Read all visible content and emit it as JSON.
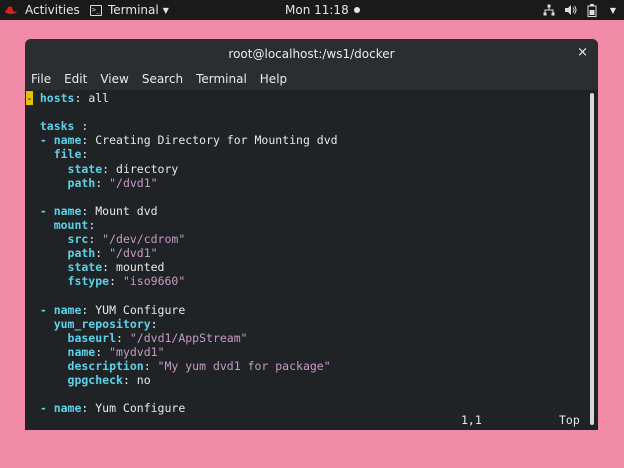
{
  "topbar": {
    "activities": "Activities",
    "app_name": "Terminal",
    "clock": "Mon 11:18"
  },
  "window": {
    "title": "root@localhost:/ws1/docker",
    "close_glyph": "×",
    "menu": [
      "File",
      "Edit",
      "View",
      "Search",
      "Terminal",
      "Help"
    ]
  },
  "editor": {
    "cursor_char": "-",
    "lines": [
      [
        {
          "t": "k",
          "v": " hosts"
        },
        {
          "t": "n",
          "v": ": all"
        }
      ],
      [],
      [
        {
          "t": "k",
          "v": "  tasks"
        },
        {
          "t": "n",
          "v": " :"
        }
      ],
      [
        {
          "t": "k",
          "v": "  - name"
        },
        {
          "t": "n",
          "v": ": Creating Directory for Mounting dvd"
        }
      ],
      [
        {
          "t": "k",
          "v": "    file"
        },
        {
          "t": "n",
          "v": ":"
        }
      ],
      [
        {
          "t": "k",
          "v": "      state"
        },
        {
          "t": "n",
          "v": ": directory"
        }
      ],
      [
        {
          "t": "k",
          "v": "      path"
        },
        {
          "t": "n",
          "v": ": "
        },
        {
          "t": "s",
          "v": "\"/dvd1\""
        }
      ],
      [],
      [
        {
          "t": "k",
          "v": "  - name"
        },
        {
          "t": "n",
          "v": ": Mount dvd"
        }
      ],
      [
        {
          "t": "k",
          "v": "    mount"
        },
        {
          "t": "n",
          "v": ":"
        }
      ],
      [
        {
          "t": "k",
          "v": "      src"
        },
        {
          "t": "n",
          "v": ": "
        },
        {
          "t": "s",
          "v": "\"/dev/cdrom\""
        }
      ],
      [
        {
          "t": "k",
          "v": "      path"
        },
        {
          "t": "n",
          "v": ": "
        },
        {
          "t": "s",
          "v": "\"/dvd1\""
        }
      ],
      [
        {
          "t": "k",
          "v": "      state"
        },
        {
          "t": "n",
          "v": ": mounted"
        }
      ],
      [
        {
          "t": "k",
          "v": "      fstype"
        },
        {
          "t": "n",
          "v": ": "
        },
        {
          "t": "s",
          "v": "\"iso9660\""
        }
      ],
      [],
      [
        {
          "t": "k",
          "v": "  - name"
        },
        {
          "t": "n",
          "v": ": YUM Configure"
        }
      ],
      [
        {
          "t": "k",
          "v": "    yum_repository"
        },
        {
          "t": "n",
          "v": ":"
        }
      ],
      [
        {
          "t": "k",
          "v": "      baseurl"
        },
        {
          "t": "n",
          "v": ": "
        },
        {
          "t": "s",
          "v": "\"/dvd1/AppStream\""
        }
      ],
      [
        {
          "t": "k",
          "v": "      name"
        },
        {
          "t": "n",
          "v": ": "
        },
        {
          "t": "s",
          "v": "\"mydvd1\""
        }
      ],
      [
        {
          "t": "k",
          "v": "      description"
        },
        {
          "t": "n",
          "v": ": "
        },
        {
          "t": "s",
          "v": "\"My yum dvd1 for package\""
        }
      ],
      [
        {
          "t": "k",
          "v": "      gpgcheck"
        },
        {
          "t": "n",
          "v": ": no"
        }
      ],
      [],
      [
        {
          "t": "k",
          "v": "  - name"
        },
        {
          "t": "n",
          "v": ": Yum Configure"
        }
      ]
    ],
    "status_position": "1,1",
    "status_scroll": "Top"
  },
  "colors": {
    "desktop": "#f08ca8",
    "key": "#5ed1e8",
    "string": "#c79ac5",
    "cursor": "#e5c100"
  },
  "icons": [
    "redhat-icon",
    "terminal-icon",
    "network-icon",
    "volume-icon",
    "battery-icon"
  ]
}
